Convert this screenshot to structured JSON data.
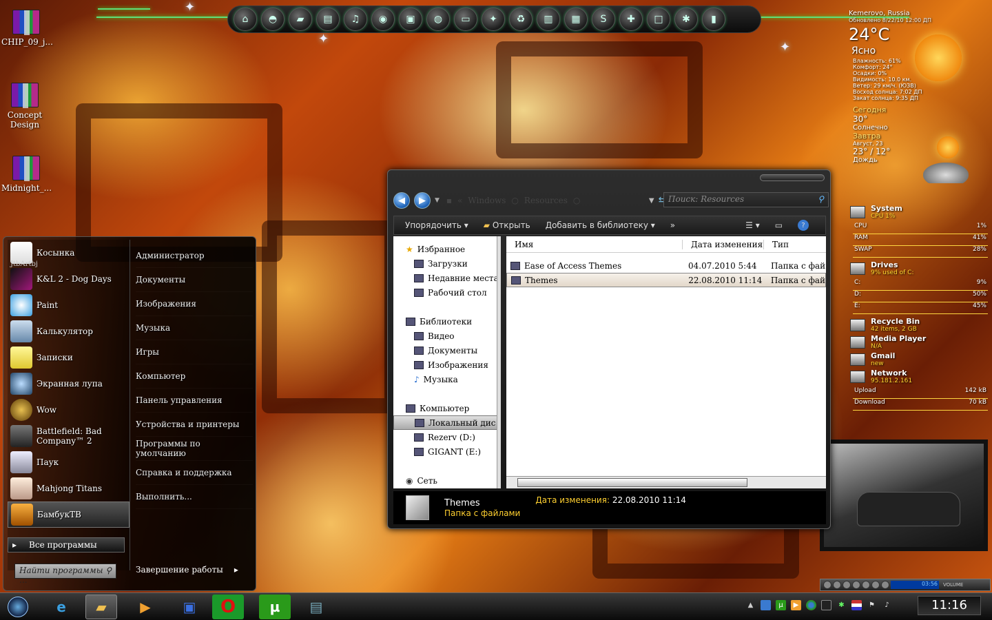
{
  "desktop": {
    "icons": [
      {
        "label": "CHIP_09_j..."
      },
      {
        "label": "Concept Design"
      },
      {
        "label": "Midnight_..."
      }
    ]
  },
  "weather": {
    "location": "Kemerovo, Russia",
    "updated": "Обновлено 8/22/10 12:00 ДП",
    "temp": "24",
    "unit": "°C",
    "condition": "Ясно",
    "details": [
      "Влажность: 61%",
      "Комфорт: 24°",
      "Осадки: 0%",
      "Видимость: 10.0 км.",
      "Ветер: 29 км/ч. (ЮЗВ)",
      "Восход солнца: 7:02 ДП",
      "Закат солнца: 9:35 ДП"
    ],
    "today_label": "Сегодня",
    "today_temp": "30°",
    "today_cond": "Солнечно",
    "tomorrow_label": "Завтра",
    "tomorrow_date": "Август, 23",
    "tomorrow_temp": "23° / 12°",
    "tomorrow_cond": "Дождь"
  },
  "system_gadget": {
    "system_title": "System",
    "system_sub": "CPU 1%",
    "cpu_label": "CPU",
    "cpu_value": "1%",
    "ram_label": "RAM",
    "ram_value": "41%",
    "swap_label": "SWAP",
    "swap_value": "28%",
    "drives_title": "Drives",
    "drives_sub": "9% used of C:",
    "drive_c": "C:",
    "drive_c_val": "9%",
    "drive_d": "D:",
    "drive_d_val": "50%",
    "drive_e": "E:",
    "drive_e_val": "45%",
    "recycle_title": "Recycle Bin",
    "recycle_sub": "42 items, 2 GB",
    "media_title": "Media Player",
    "media_sub": "N/A",
    "gmail_title": "Gmail",
    "gmail_sub": "new",
    "network_title": "Network",
    "network_sub": "95.181.2.161",
    "upload_label": "Upload",
    "upload_value": "142 kB",
    "download_label": "Download",
    "download_value": "70 kB"
  },
  "media_player": {
    "time": "03:56",
    "volume_label": "VOLUME"
  },
  "start_menu": {
    "programs": [
      {
        "label": "Косынка"
      },
      {
        "label": "K&L 2 - Dog Days"
      },
      {
        "label": "Paint"
      },
      {
        "label": "Калькулятор"
      },
      {
        "label": "Записки"
      },
      {
        "label": "Экранная лупа"
      },
      {
        "label": "Wow"
      },
      {
        "label": "Battlefield: Bad Company™ 2"
      },
      {
        "label": "Паук"
      },
      {
        "label": "Mahjong Titans"
      },
      {
        "label": "БамбукТВ"
      }
    ],
    "all_programs": "Все программы",
    "search_placeholder": "Найти программы ...",
    "user_label": "JtbArtbj",
    "right_items": [
      "Администратор",
      "Документы",
      "Изображения",
      "Музыка",
      "Игры",
      "Компьютер",
      "Панель управления",
      "Устройства и принтеры",
      "Программы по умолчанию",
      "Справка и поддержка",
      "Выполнить..."
    ],
    "shutdown": "Завершение работы"
  },
  "explorer": {
    "breadcrumb": [
      "Windows",
      "Resources"
    ],
    "search_placeholder": "Поиск: Resources",
    "commands": {
      "organize": "Упорядочить",
      "open": "Открыть",
      "add_library": "Добавить в библиотеку",
      "more": "»"
    },
    "nav": {
      "favorites": "Избранное",
      "downloads": "Загрузки",
      "recent": "Недавние места",
      "desktop": "Рабочий стол",
      "libraries": "Библиотеки",
      "video": "Видео",
      "documents": "Документы",
      "images": "Изображения",
      "music": "Музыка",
      "computer": "Компьютер",
      "local_disk": "Локальный дис",
      "rezerv": "Rezerv (D:)",
      "gigant": "GIGANT (E:)",
      "network": "Сеть"
    },
    "columns": {
      "name": "Имя",
      "date": "Дата изменения",
      "type": "Тип"
    },
    "files": [
      {
        "name": "Ease of Access Themes",
        "date": "04.07.2010 5:44",
        "type": "Папка с фай"
      },
      {
        "name": "Themes",
        "date": "22.08.2010 11:14",
        "type": "Папка с фай"
      }
    ],
    "details": {
      "name": "Themes",
      "date_label": "Дата изменения:",
      "date_value": "22.08.2010 11:14",
      "type": "Папка с файлами"
    }
  },
  "taskbar": {
    "clock": "11:16"
  }
}
